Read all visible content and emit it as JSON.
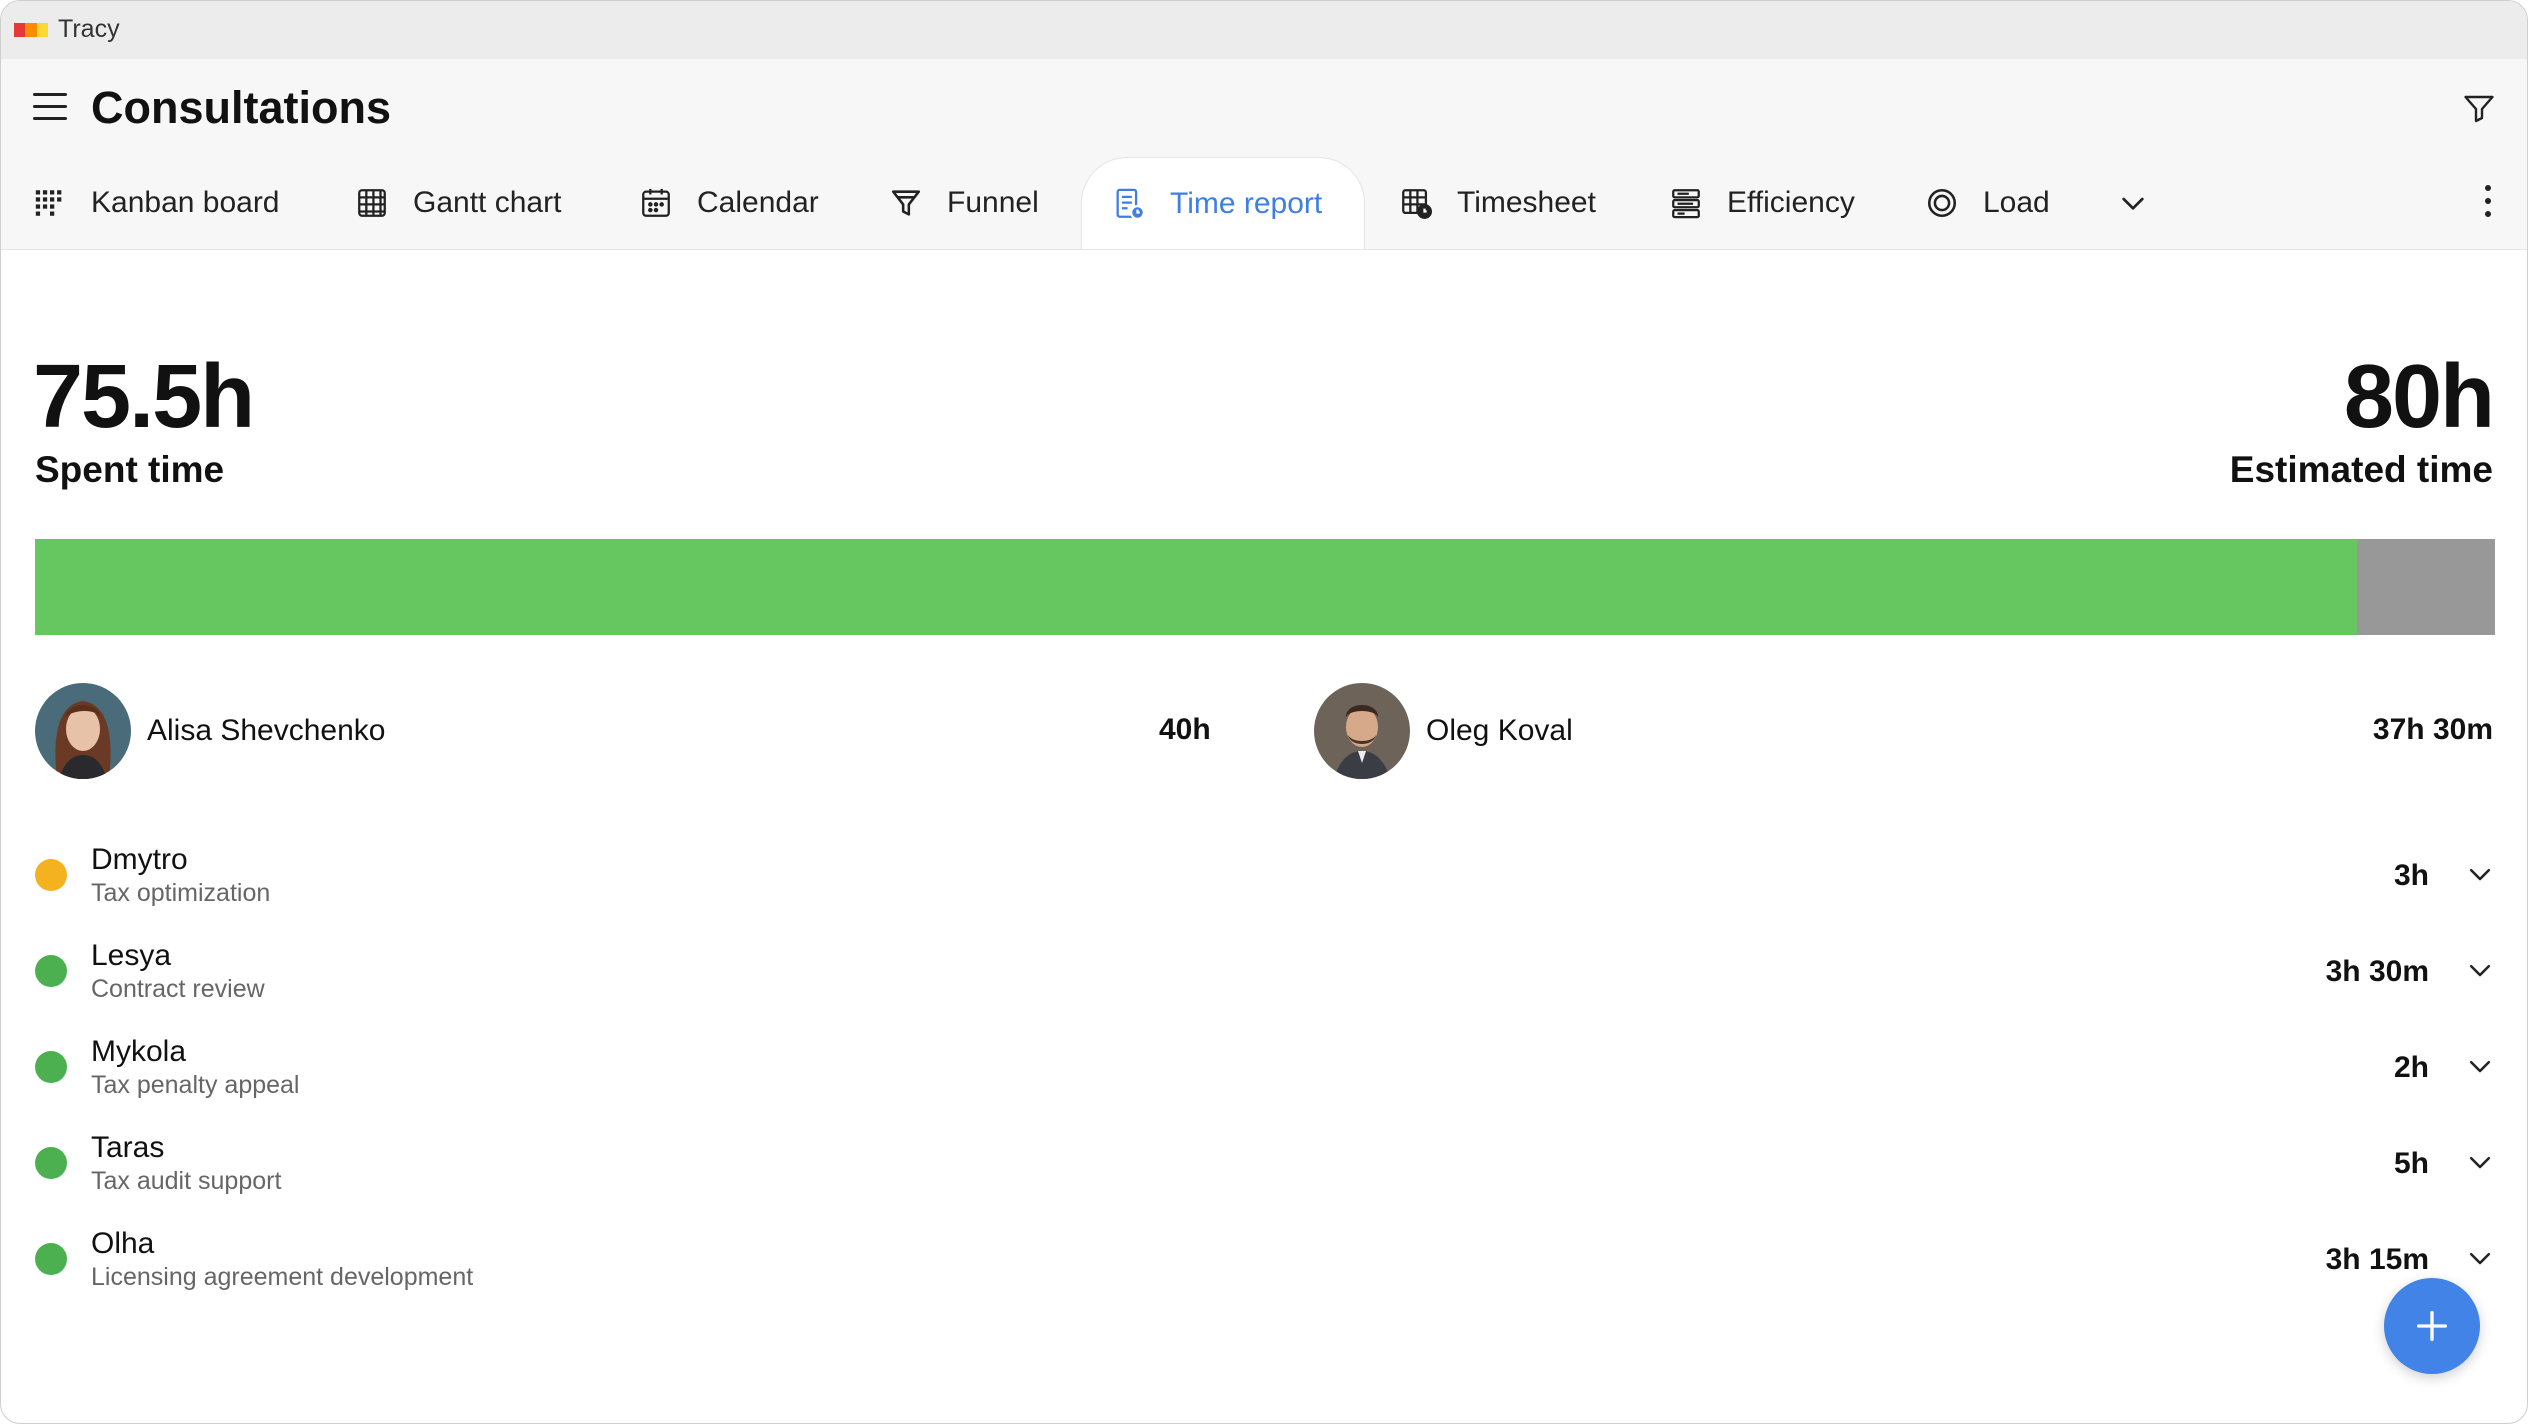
{
  "window": {
    "app_title": "Tracy",
    "logo_colors": [
      "#e53935",
      "#fb8c00",
      "#fdd835"
    ]
  },
  "header": {
    "title": "Consultations",
    "menu_icon": "hamburger-menu-icon",
    "filter_icon": "filter-icon"
  },
  "tabs": [
    {
      "label": "Kanban board",
      "icon": "kanban-icon",
      "active": false
    },
    {
      "label": "Gantt chart",
      "icon": "gantt-icon",
      "active": false
    },
    {
      "label": "Calendar",
      "icon": "calendar-icon",
      "active": false
    },
    {
      "label": "Funnel",
      "icon": "funnel-icon",
      "active": false
    },
    {
      "label": "Time report",
      "icon": "time-report-icon",
      "active": true
    },
    {
      "label": "Timesheet",
      "icon": "timesheet-icon",
      "active": false
    },
    {
      "label": "Efficiency",
      "icon": "efficiency-icon",
      "active": false
    },
    {
      "label": "Load",
      "icon": "load-icon",
      "active": false
    }
  ],
  "summary": {
    "spent_value": "75.5h",
    "spent_label": "Spent time",
    "estimated_value": "80h",
    "estimated_label": "Estimated time",
    "progress_fraction": 0.944,
    "progress_color": "#66c760",
    "remaining_color": "#989898"
  },
  "people": [
    {
      "name": "Alisa Shevchenko",
      "hours": "40h"
    },
    {
      "name": "Oleg Koval",
      "hours": "37h 30m"
    }
  ],
  "clients": [
    {
      "name": "Dmytro",
      "task": "Tax optimization",
      "hours": "3h",
      "status_color": "#f4b120"
    },
    {
      "name": "Lesya",
      "task": "Contract review",
      "hours": "3h 30m",
      "status_color": "#4caf50"
    },
    {
      "name": "Mykola",
      "task": "Tax penalty appeal",
      "hours": "2h",
      "status_color": "#4caf50"
    },
    {
      "name": "Taras",
      "task": "Tax audit support",
      "hours": "5h",
      "status_color": "#4caf50"
    },
    {
      "name": "Olha",
      "task": "Licensing agreement development",
      "hours": "3h 15m",
      "status_color": "#4caf50"
    }
  ],
  "accent_color": "#3f7fe0",
  "fab_icon": "plus-icon"
}
